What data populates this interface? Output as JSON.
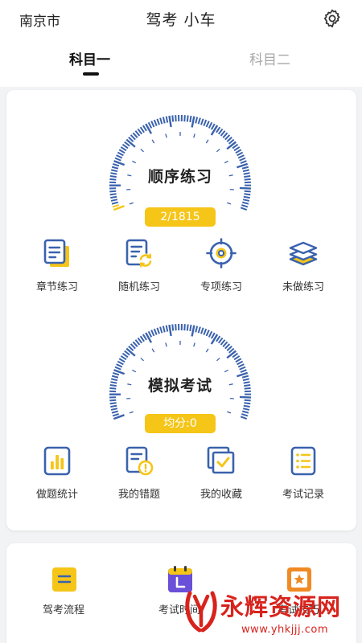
{
  "header": {
    "city": "南京市",
    "title": "驾考 小车",
    "settings_icon": "gear-icon"
  },
  "tabs": [
    {
      "label": "科目一",
      "active": true
    },
    {
      "label": "科目二",
      "active": false
    }
  ],
  "practice": {
    "label": "顺序练习",
    "progress_text": "2/1815",
    "progress_done": 2,
    "progress_total": 1815,
    "modes": [
      {
        "label": "章节练习",
        "icon": "document-icon"
      },
      {
        "label": "随机练习",
        "icon": "shuffle-icon"
      },
      {
        "label": "专项练习",
        "icon": "target-icon"
      },
      {
        "label": "未做练习",
        "icon": "layers-icon"
      }
    ]
  },
  "exam": {
    "label": "模拟考试",
    "score_text": "均分:0",
    "tools": [
      {
        "label": "做题统计",
        "icon": "bar-chart-icon"
      },
      {
        "label": "我的错题",
        "icon": "error-icon"
      },
      {
        "label": "我的收藏",
        "icon": "favorites-icon"
      },
      {
        "label": "考试记录",
        "icon": "record-list-icon"
      }
    ]
  },
  "more": {
    "items": [
      {
        "label": "驾考流程",
        "icon": "flow-icon"
      },
      {
        "label": "考试时间",
        "icon": "calendar-icon"
      },
      {
        "label": "考试技巧",
        "icon": "star-icon"
      }
    ]
  },
  "watermark": {
    "text": "永辉资源网",
    "url": "www.yhkjjj.com"
  },
  "colors": {
    "blue": "#3a62ad",
    "yellow": "#f5c518",
    "orange": "#f08a24",
    "purple": "#6a4fd8",
    "red": "#d8231c"
  }
}
